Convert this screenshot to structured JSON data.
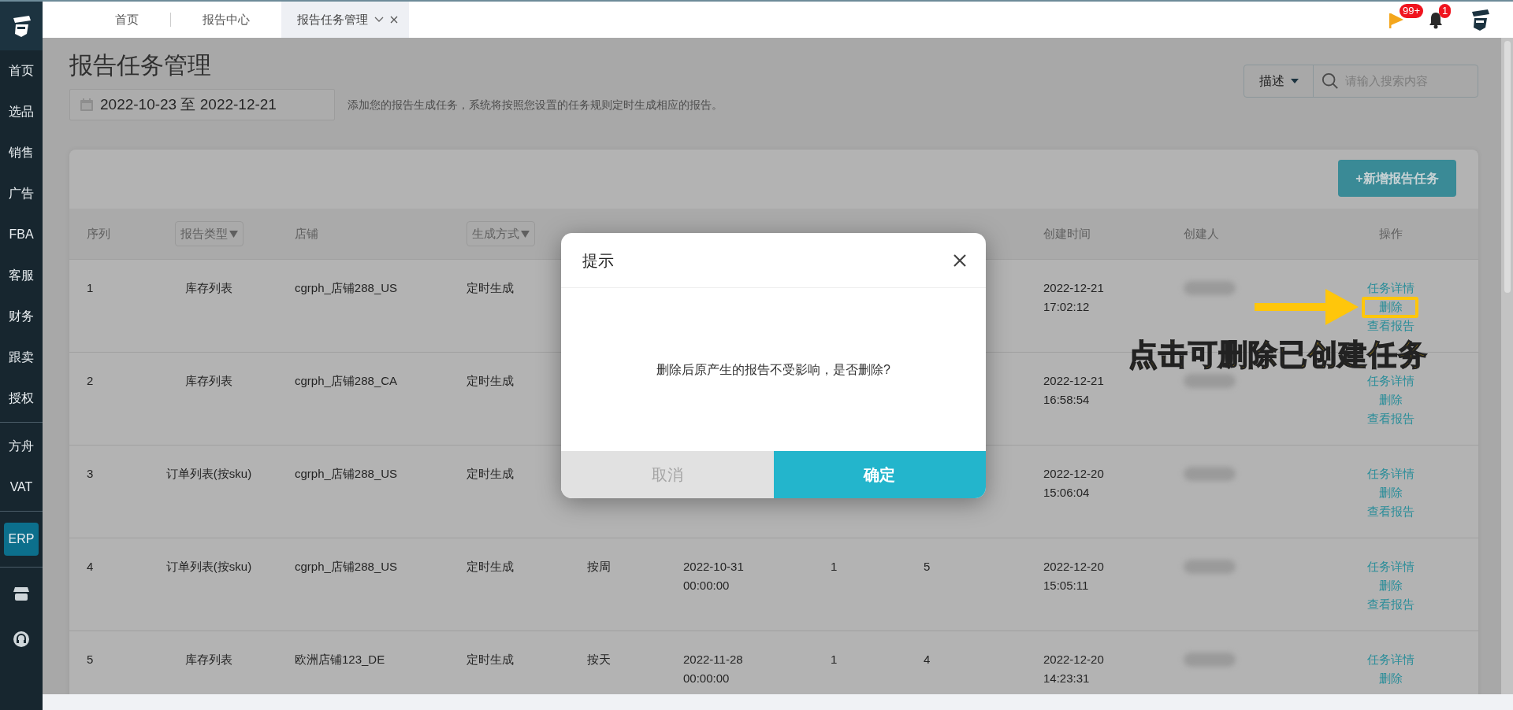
{
  "top_bar": {
    "tabs": [
      {
        "label": "首页",
        "selected": false,
        "closable": false
      },
      {
        "label": "报告中心",
        "selected": false,
        "closable": false
      },
      {
        "label": "报告任务管理",
        "selected": true,
        "closable": true
      }
    ],
    "notifications": [
      {
        "kind": "flag",
        "badge": "99+"
      },
      {
        "kind": "bell",
        "badge": "1"
      }
    ]
  },
  "sidebar": {
    "groups": [
      [
        {
          "label": "首页",
          "selected": false
        },
        {
          "label": "选品",
          "selected": false
        },
        {
          "label": "销售",
          "selected": false
        },
        {
          "label": "广告",
          "selected": false
        },
        {
          "label": "FBA",
          "selected": false
        },
        {
          "label": "客服",
          "selected": false
        },
        {
          "label": "财务",
          "selected": false
        },
        {
          "label": "跟卖",
          "selected": false
        },
        {
          "label": "授权",
          "selected": false
        }
      ],
      [
        {
          "label": "方舟",
          "selected": false
        },
        {
          "label": "VAT",
          "selected": false
        }
      ],
      [
        {
          "label": "ERP",
          "selected": true
        }
      ]
    ],
    "bottom_items": [
      {
        "kind": "store"
      },
      {
        "kind": "support"
      }
    ]
  },
  "page": {
    "title": "报告任务管理",
    "date_range": "2022-10-23 至 2022-12-21",
    "hint": "添加您的报告生成任务，系统将按照您设置的任务规则定时生成相应的报告。",
    "search": {
      "field": "描述",
      "placeholder": "请输入搜索内容"
    },
    "add_button": "+新增报告任务"
  },
  "table": {
    "columns": {
      "index": {
        "label": "序列",
        "dropdown": false
      },
      "report_type": {
        "label": "报告类型",
        "dropdown": true
      },
      "store": {
        "label": "店铺",
        "dropdown": false
      },
      "method": {
        "label": "生成方式",
        "dropdown": true
      },
      "created": {
        "label": "创建时间",
        "dropdown": false
      },
      "creator": {
        "label": "创建人",
        "dropdown": false
      },
      "actions": {
        "label": "操作",
        "dropdown": false
      }
    },
    "rows": [
      {
        "index": "1",
        "report_type": "库存列表",
        "store": "cgrph_店铺288_US",
        "method": "定时生成",
        "created": [
          "2022-12-21",
          "17:02:12"
        ],
        "creator_blurred": true,
        "actions": [
          "任务详情",
          "删除",
          "查看报告"
        ]
      },
      {
        "index": "2",
        "report_type": "库存列表",
        "store": "cgrph_店铺288_CA",
        "method": "定时生成",
        "created": [
          "2022-12-21",
          "16:58:54"
        ],
        "creator_blurred": true,
        "actions": [
          "任务详情",
          "删除",
          "查看报告"
        ]
      },
      {
        "index": "3",
        "report_type": "订单列表(按sku)",
        "store": "cgrph_店铺288_US",
        "method": "定时生成",
        "created": [
          "2022-12-20",
          "15:06:04"
        ],
        "creator_blurred": true,
        "actions": [
          "任务详情",
          "删除",
          "查看报告"
        ]
      },
      {
        "index": "4",
        "report_type": "订单列表(按sku)",
        "store": "cgrph_店铺288_US",
        "method": "定时生成",
        "period": "按周",
        "start_time": [
          "2022-10-31",
          "00:00:00"
        ],
        "runs": "1",
        "description": "5",
        "created": [
          "2022-12-20",
          "15:05:11"
        ],
        "creator_blurred": true,
        "actions": [
          "任务详情",
          "删除",
          "查看报告"
        ]
      },
      {
        "index": "5",
        "report_type": "库存列表",
        "store": "欧洲店铺123_DE",
        "method": "定时生成",
        "period": "按天",
        "start_time": [
          "2022-11-28",
          "00:00:00"
        ],
        "runs": "1",
        "description": "4",
        "created": [
          "2022-12-20",
          "14:23:31"
        ],
        "creator_blurred": true,
        "actions": [
          "任务详情",
          "删除"
        ]
      }
    ]
  },
  "dialog": {
    "title": "提示",
    "message": "删除后原产生的报告不受影响，是否删除?",
    "cancel": "取消",
    "confirm": "确定"
  },
  "annotation": {
    "callout": "点击可删除已创建任务"
  }
}
